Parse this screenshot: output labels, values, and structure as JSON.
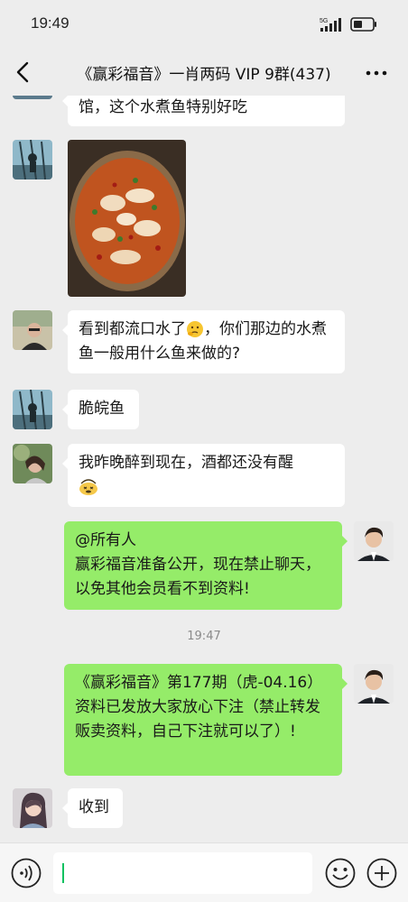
{
  "status_bar": {
    "time": "19:49",
    "network": "5G",
    "icons": [
      "signal-icon",
      "battery-icon"
    ]
  },
  "header": {
    "back_icon": "chevron-left-icon",
    "title": "《赢彩福音》一肖两码 VIP 9群(437)",
    "more_icon": "more-icon"
  },
  "messages": [
    {
      "side": "left",
      "type": "text",
      "text": "馆，这个水煮鱼特别好吃"
    },
    {
      "side": "left",
      "type": "image",
      "alt": "水煮鱼"
    },
    {
      "side": "left",
      "type": "text",
      "text": "看到都流口水了",
      "text_rest": "，你们那边的水煮鱼一般用什么鱼来做的?",
      "emoji": "thinking-emoji"
    },
    {
      "side": "left",
      "type": "text",
      "text": "脆皖鱼"
    },
    {
      "side": "left",
      "type": "text",
      "text": "我昨晚醉到现在，酒都还没有醒",
      "emoji": "dizzy-emoji"
    },
    {
      "side": "right",
      "type": "text",
      "line1": "@所有人",
      "text": "赢彩福音准备公开，现在禁止聊天，以免其他会员看不到资料!"
    },
    {
      "type": "timestamp",
      "text": "19:47"
    },
    {
      "side": "right",
      "type": "text",
      "text": "《赢彩福音》第177期（虎-04.16）资料已发放大家放心下注（禁止转发贩卖资料，自己下注就可以了）!"
    },
    {
      "side": "left",
      "type": "text",
      "text": "收到"
    }
  ],
  "input_bar": {
    "voice_icon": "voice-icon",
    "emoji_icon": "emoji-icon",
    "plus_icon": "plus-icon",
    "value": ""
  },
  "colors": {
    "background": "#ededed",
    "bubble_self": "#95ec69",
    "bubble_other": "#ffffff",
    "caret": "#07c160"
  }
}
